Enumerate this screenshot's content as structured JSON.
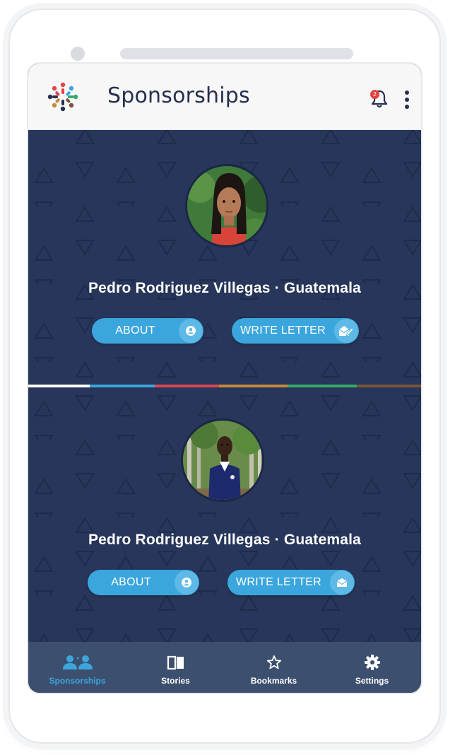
{
  "header": {
    "title": "Sponsorships",
    "notification_count": "2",
    "icons": {
      "logo": "app-logo",
      "bell": "bell-icon",
      "menu": "more-vertical-icon"
    }
  },
  "sponsorships": [
    {
      "name": "Pedro Rodriguez Villegas · Guatemala",
      "about_label": "ABOUT",
      "write_label": "WRITE LETTER",
      "about_icon": "user-circle-icon",
      "write_icon": "edit-letter-icon"
    },
    {
      "name": "Pedro Rodriguez Villegas · Guatemala",
      "about_label": "ABOUT",
      "write_label": "WRITE LETTER",
      "about_icon": "user-circle-icon",
      "write_icon": "envelope-icon"
    }
  ],
  "divider_colors": [
    "#ffffff",
    "#3ba6dd",
    "#d9484e",
    "#c6893a",
    "#35a86b",
    "#7a5538"
  ],
  "bottom_nav": {
    "items": [
      {
        "label": "Sponsorships",
        "icon": "people-icon",
        "active": true
      },
      {
        "label": "Stories",
        "icon": "book-icon",
        "active": false
      },
      {
        "label": "Bookmarks",
        "icon": "star-icon",
        "active": false
      },
      {
        "label": "Settings",
        "icon": "gear-icon",
        "active": false
      }
    ]
  },
  "colors": {
    "accent": "#3ba6dd",
    "background": "#27365a",
    "nav_background": "#3d4f6e",
    "badge": "#e4433f"
  }
}
